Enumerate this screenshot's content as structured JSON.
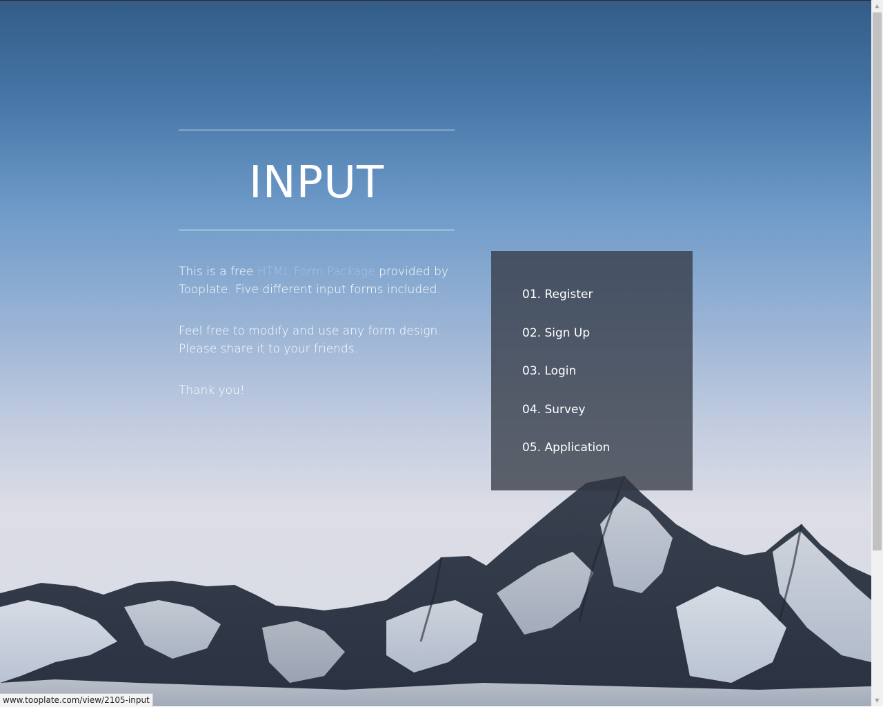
{
  "hero": {
    "title": "INPUT"
  },
  "intro": {
    "line1_pre": "This is a free ",
    "line1_link": "HTML Form Package",
    "line1_post": " provided by Tooplate. Five different input forms included.",
    "paragraph2": "Feel free to modify and use any form design. Please share it to your friends.",
    "paragraph3": "Thank you!"
  },
  "menu": {
    "items": [
      {
        "label": "01. Register"
      },
      {
        "label": "02. Sign Up"
      },
      {
        "label": "03. Login"
      },
      {
        "label": "04. Survey"
      },
      {
        "label": "05. Application"
      }
    ]
  },
  "status": {
    "url": "www.tooplate.com/view/2105-input"
  },
  "colors": {
    "link": "#9cc3ee",
    "panel": "#323742"
  }
}
